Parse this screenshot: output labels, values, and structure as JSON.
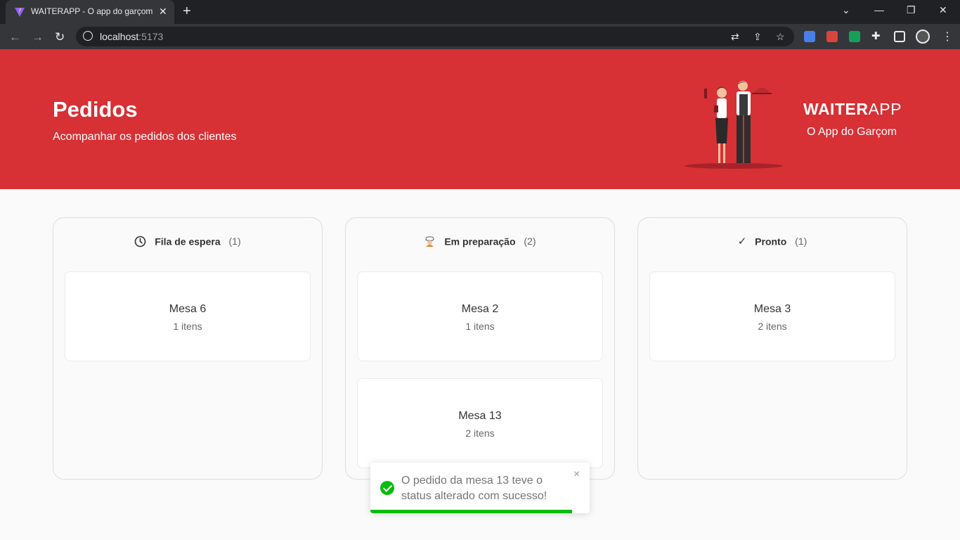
{
  "browser": {
    "tab_title": "WAITERAPP - O app do garçom",
    "url_host": "localhost",
    "url_port": ":5173"
  },
  "header": {
    "title": "Pedidos",
    "subtitle": "Acompanhar os pedidos dos clientes",
    "brand_bold": "WAITER",
    "brand_light": "APP",
    "brand_tagline": "O App do Garçom"
  },
  "board": {
    "columns": [
      {
        "icon": "clock-icon",
        "name": "Fila de espera",
        "count": "(1)",
        "orders": [
          {
            "table": "Mesa 6",
            "items": "1 itens"
          }
        ]
      },
      {
        "icon": "chef-icon",
        "name": "Em preparação",
        "count": "(2)",
        "orders": [
          {
            "table": "Mesa 2",
            "items": "1 itens"
          },
          {
            "table": "Mesa 13",
            "items": "2 itens"
          }
        ]
      },
      {
        "icon": "check-icon",
        "name": "Pronto",
        "count": "(1)",
        "orders": [
          {
            "table": "Mesa 3",
            "items": "2 itens"
          }
        ]
      }
    ]
  },
  "toast": {
    "message": "O pedido da mesa 13 teve o status alterado com sucesso!",
    "close": "×",
    "progress": 0.92,
    "color": "#07bc0c"
  },
  "colors": {
    "brand": "#d73035",
    "background": "#fafafa"
  }
}
